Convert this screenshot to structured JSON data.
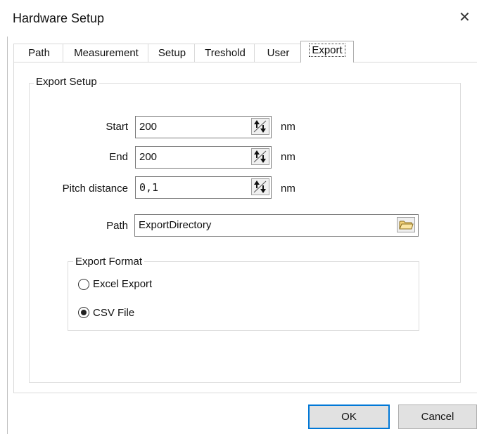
{
  "window": {
    "title": "Hardware Setup",
    "close_glyph": "✕"
  },
  "tabs": [
    "Path",
    "Measurement",
    "Setup",
    "Treshold",
    "User",
    "Export"
  ],
  "active_tab": "Export",
  "export_setup": {
    "group_label": "Export Setup",
    "start": {
      "label": "Start",
      "value": "200",
      "unit": "nm"
    },
    "end": {
      "label": "End",
      "value": "200",
      "unit": "nm"
    },
    "pitch": {
      "label": "Pitch distance",
      "value": "0,1",
      "unit": "nm"
    },
    "path": {
      "label": "Path",
      "value": "ExportDirectory",
      "browse_icon": "folder-icon"
    }
  },
  "export_format": {
    "group_label": "Export Format",
    "options": [
      "Excel Export",
      "CSV File"
    ],
    "selected": "CSV File"
  },
  "buttons": {
    "ok": "OK",
    "cancel": "Cancel"
  },
  "colors": {
    "default_button_border": "#0078d7",
    "button_face": "#e1e1e1"
  }
}
